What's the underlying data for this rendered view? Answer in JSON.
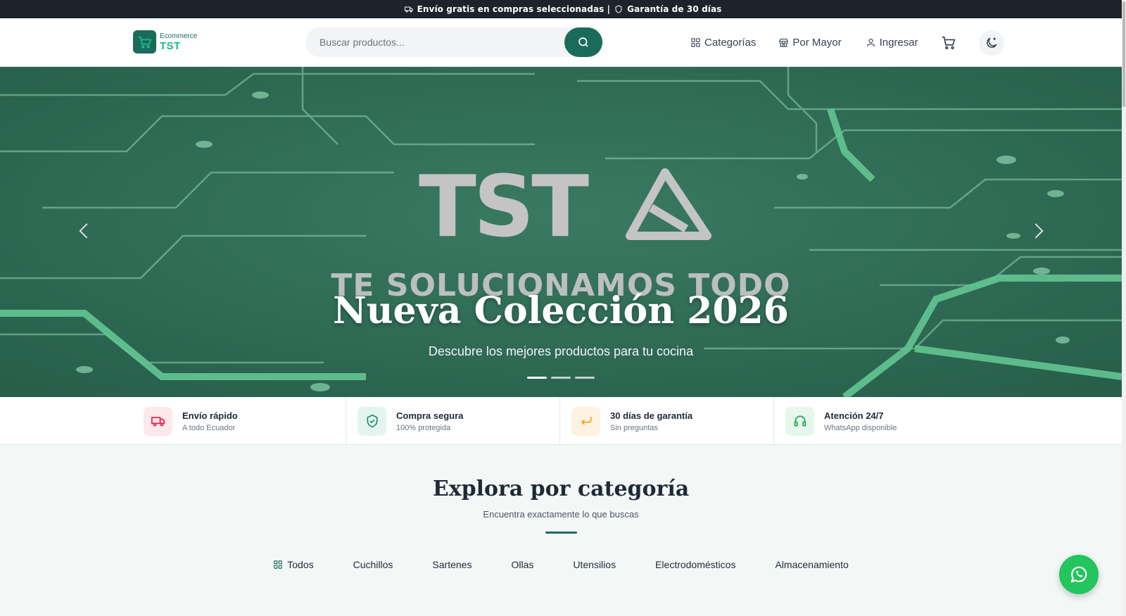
{
  "announce": {
    "text": "Envío gratis en compras seleccionadas | ",
    "guarantee": "Garantía de 30 días"
  },
  "header": {
    "logo_small": "Ecommerce",
    "logo_big": "TST",
    "search_placeholder": "Buscar productos...",
    "nav": {
      "categories": "Categorías",
      "wholesale": "Por Mayor",
      "login": "Ingresar"
    }
  },
  "hero": {
    "brand": "TST",
    "tagline": "TE SOLUCIONAMOS TODO",
    "title": "Nueva Colección 2026",
    "subtitle": "Descubre los mejores productos para tu cocina",
    "slides": 3,
    "active_slide": 1
  },
  "features": [
    {
      "title": "Envío rápido",
      "subtitle": "A todo Ecuador",
      "icon": "truck-icon",
      "color": "#e11d48",
      "bg": "#fde8ec"
    },
    {
      "title": "Compra segura",
      "subtitle": "100% protegida",
      "icon": "shield-check-icon",
      "color": "#1b8a6b",
      "bg": "#e3f5ee"
    },
    {
      "title": "30 días de garantía",
      "subtitle": "Sin preguntas",
      "icon": "return-arrow-icon",
      "color": "#f59e0b",
      "bg": "#fef3e2"
    },
    {
      "title": "Atención 24/7",
      "subtitle": "WhatsApp disponible",
      "icon": "headset-icon",
      "color": "#16a34a",
      "bg": "#e6f7ec"
    }
  ],
  "categories": {
    "title": "Explora por categoría",
    "subtitle": "Encuentra exactamente lo que buscas",
    "tabs": [
      "Todos",
      "Cuchillos",
      "Sartenes",
      "Ollas",
      "Utensilios",
      "Electrodomésticos",
      "Almacenamiento"
    ]
  },
  "colors": {
    "primary": "#1b6b5a",
    "accent": "#19b88a",
    "topbar": "#1e232b",
    "hero_bg": "#2e6d57",
    "whatsapp": "#22c55e"
  }
}
